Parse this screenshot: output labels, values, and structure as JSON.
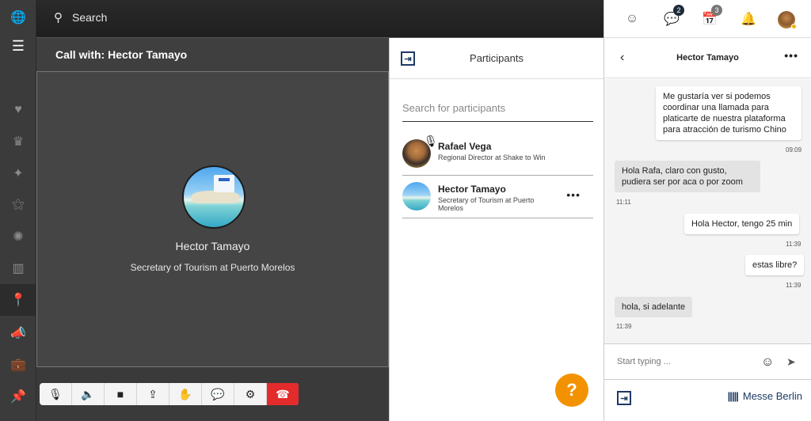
{
  "rail": {
    "items": [
      {
        "icon": "globe-icon",
        "glyph": "🌐"
      },
      {
        "icon": "menu-icon",
        "glyph": "☰"
      },
      {
        "icon": "heart-icon",
        "glyph": "♥"
      },
      {
        "icon": "crown-icon",
        "glyph": "♛"
      },
      {
        "icon": "magic-wand-icon",
        "glyph": "✦"
      },
      {
        "icon": "network-icon",
        "glyph": "⚝"
      },
      {
        "icon": "hub-icon",
        "glyph": "✺"
      },
      {
        "icon": "trash-icon",
        "glyph": "▥"
      },
      {
        "icon": "location-pin-icon",
        "glyph": "📍"
      },
      {
        "icon": "megaphone-icon",
        "glyph": "📣"
      },
      {
        "icon": "briefcase-icon",
        "glyph": "💼"
      },
      {
        "icon": "pin-icon",
        "glyph": "📌"
      }
    ]
  },
  "topbar": {
    "search_label": "Search"
  },
  "call": {
    "title": "Call with: Hector Tamayo",
    "participant_name": "Hector Tamayo",
    "participant_role": "Secretary of Tourism at Puerto Morelos"
  },
  "controls": [
    {
      "name": "mute-mic-icon",
      "glyph": "🎙"
    },
    {
      "name": "speaker-mute-icon",
      "glyph": "🔈"
    },
    {
      "name": "video-camera-icon",
      "glyph": "■"
    },
    {
      "name": "share-screen-icon",
      "glyph": "⇪"
    },
    {
      "name": "raise-hand-icon",
      "glyph": "✋"
    },
    {
      "name": "chat-bubbles-icon",
      "glyph": "💬"
    },
    {
      "name": "settings-gear-icon",
      "glyph": "⚙"
    },
    {
      "name": "end-call-icon",
      "glyph": "☎"
    }
  ],
  "participants": {
    "title": "Participants",
    "search_placeholder": "Search for participants",
    "list": [
      {
        "name": "Rafael Vega",
        "role": "Regional Director at Shake to Win",
        "muted": true
      },
      {
        "name": "Hector Tamayo",
        "role": "Secretary of Tourism at Puerto Morelos",
        "more": "•••"
      }
    ]
  },
  "help_label": "?",
  "header_icons": {
    "chat_badge": "2",
    "calendar_badge": "3"
  },
  "chat": {
    "title": "Hector Tamayo",
    "more": "•••",
    "messages": [
      {
        "dir": "out",
        "text": "Me gustaría ver si podemos coordinar una llamada para platicarte de nuestra plataforma para atracción de turismo Chino",
        "time": "09:09"
      },
      {
        "dir": "in",
        "text": "Hola Rafa, claro con gusto, pudiera ser por aca o por zoom",
        "time": "11:11"
      },
      {
        "dir": "out",
        "text": "Hola Hector, tengo 25 min",
        "time": "11:39"
      },
      {
        "dir": "out",
        "text": "estas libre?",
        "time": "11:39"
      },
      {
        "dir": "in",
        "text": "hola, si adelante",
        "time": "11:39"
      }
    ],
    "composer_placeholder": "Start typing ..."
  },
  "footer": {
    "brand": "Messe Berlin",
    "brand_bars": "|||||"
  }
}
